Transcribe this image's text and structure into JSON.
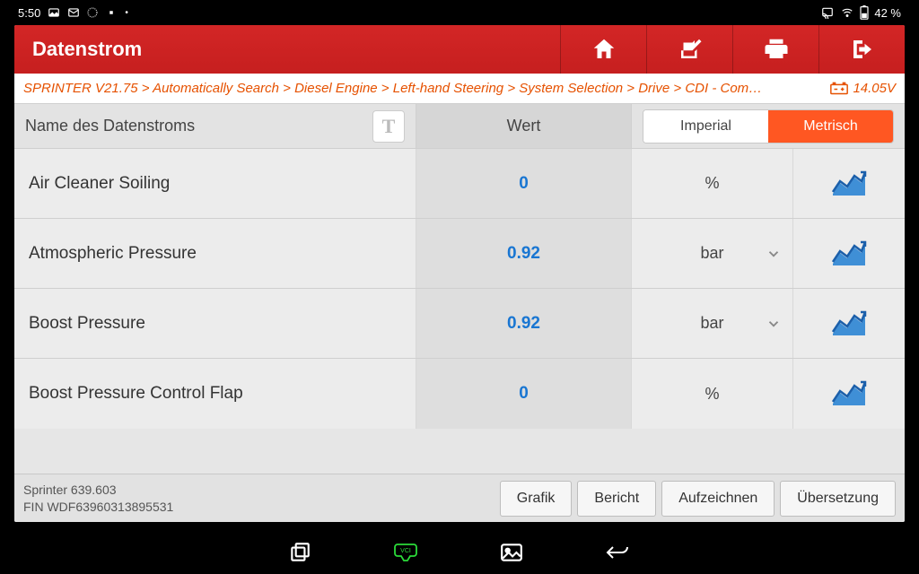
{
  "statusbar": {
    "time": "5:50",
    "battery_text": "42 %"
  },
  "header": {
    "title": "Datenstrom"
  },
  "breadcrumb": {
    "text": "SPRINTER V21.75 > Automatically Search > Diesel Engine > Left-hand Steering > System Selection > Drive > CDI -  Com…",
    "voltage": "14.05V"
  },
  "columns": {
    "name": "Name des Datenstroms",
    "value": "Wert",
    "unit_imperial": "Imperial",
    "unit_metric": "Metrisch"
  },
  "rows": [
    {
      "name": "Air Cleaner Soiling",
      "value": "0",
      "unit": "%",
      "expandable": false
    },
    {
      "name": "Atmospheric Pressure",
      "value": "0.92",
      "unit": "bar",
      "expandable": true
    },
    {
      "name": "Boost Pressure",
      "value": "0.92",
      "unit": "bar",
      "expandable": true
    },
    {
      "name": "Boost Pressure Control Flap",
      "value": "0",
      "unit": "%",
      "expandable": false
    }
  ],
  "footer": {
    "vehicle": "Sprinter 639.603",
    "vin": "FIN WDF63960313895531",
    "btn_graph": "Grafik",
    "btn_report": "Bericht",
    "btn_record": "Aufzeichnen",
    "btn_translate": "Übersetzung"
  }
}
